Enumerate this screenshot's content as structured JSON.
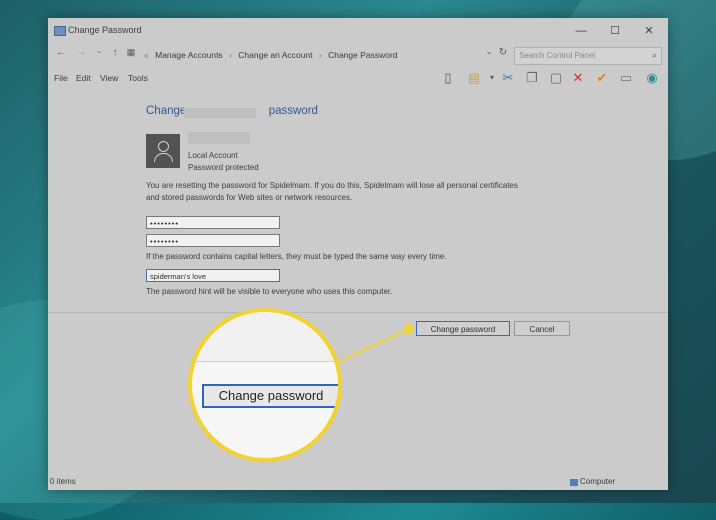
{
  "window": {
    "title": "Change Password",
    "controls": {
      "minimize": "—",
      "maximize": "☐",
      "close": "✕"
    }
  },
  "address": {
    "crumbs": [
      "Manage Accounts",
      "Change an Account",
      "Change Password"
    ],
    "search_placeholder": "Search Control Panel"
  },
  "menu": {
    "items": [
      "File",
      "Edit",
      "View",
      "Tools"
    ]
  },
  "page": {
    "heading_prefix": "Change",
    "heading_suffix": "password",
    "account_type": "Local Account",
    "account_status": "Password protected",
    "warning_line1": "You are resetting the password for Spidelmam.  If you do this, Spidelmam will lose all personal certificates",
    "warning_line2": "and stored passwords for Web sites or network resources.",
    "new_password": "••••••••",
    "confirm_password": "••••••••",
    "caps_note": "If the password contains capital letters, they must be typed the same way every time.",
    "hint_value": "spiderman's love",
    "hint_note": "The password hint will be visible to everyone who uses this computer.",
    "change_button": "Change password",
    "cancel_button": "Cancel"
  },
  "status": {
    "items": "0 items",
    "location": "Computer"
  },
  "callout": {
    "zoom_label": "Change password",
    "accent_color": "#f2d22e"
  }
}
